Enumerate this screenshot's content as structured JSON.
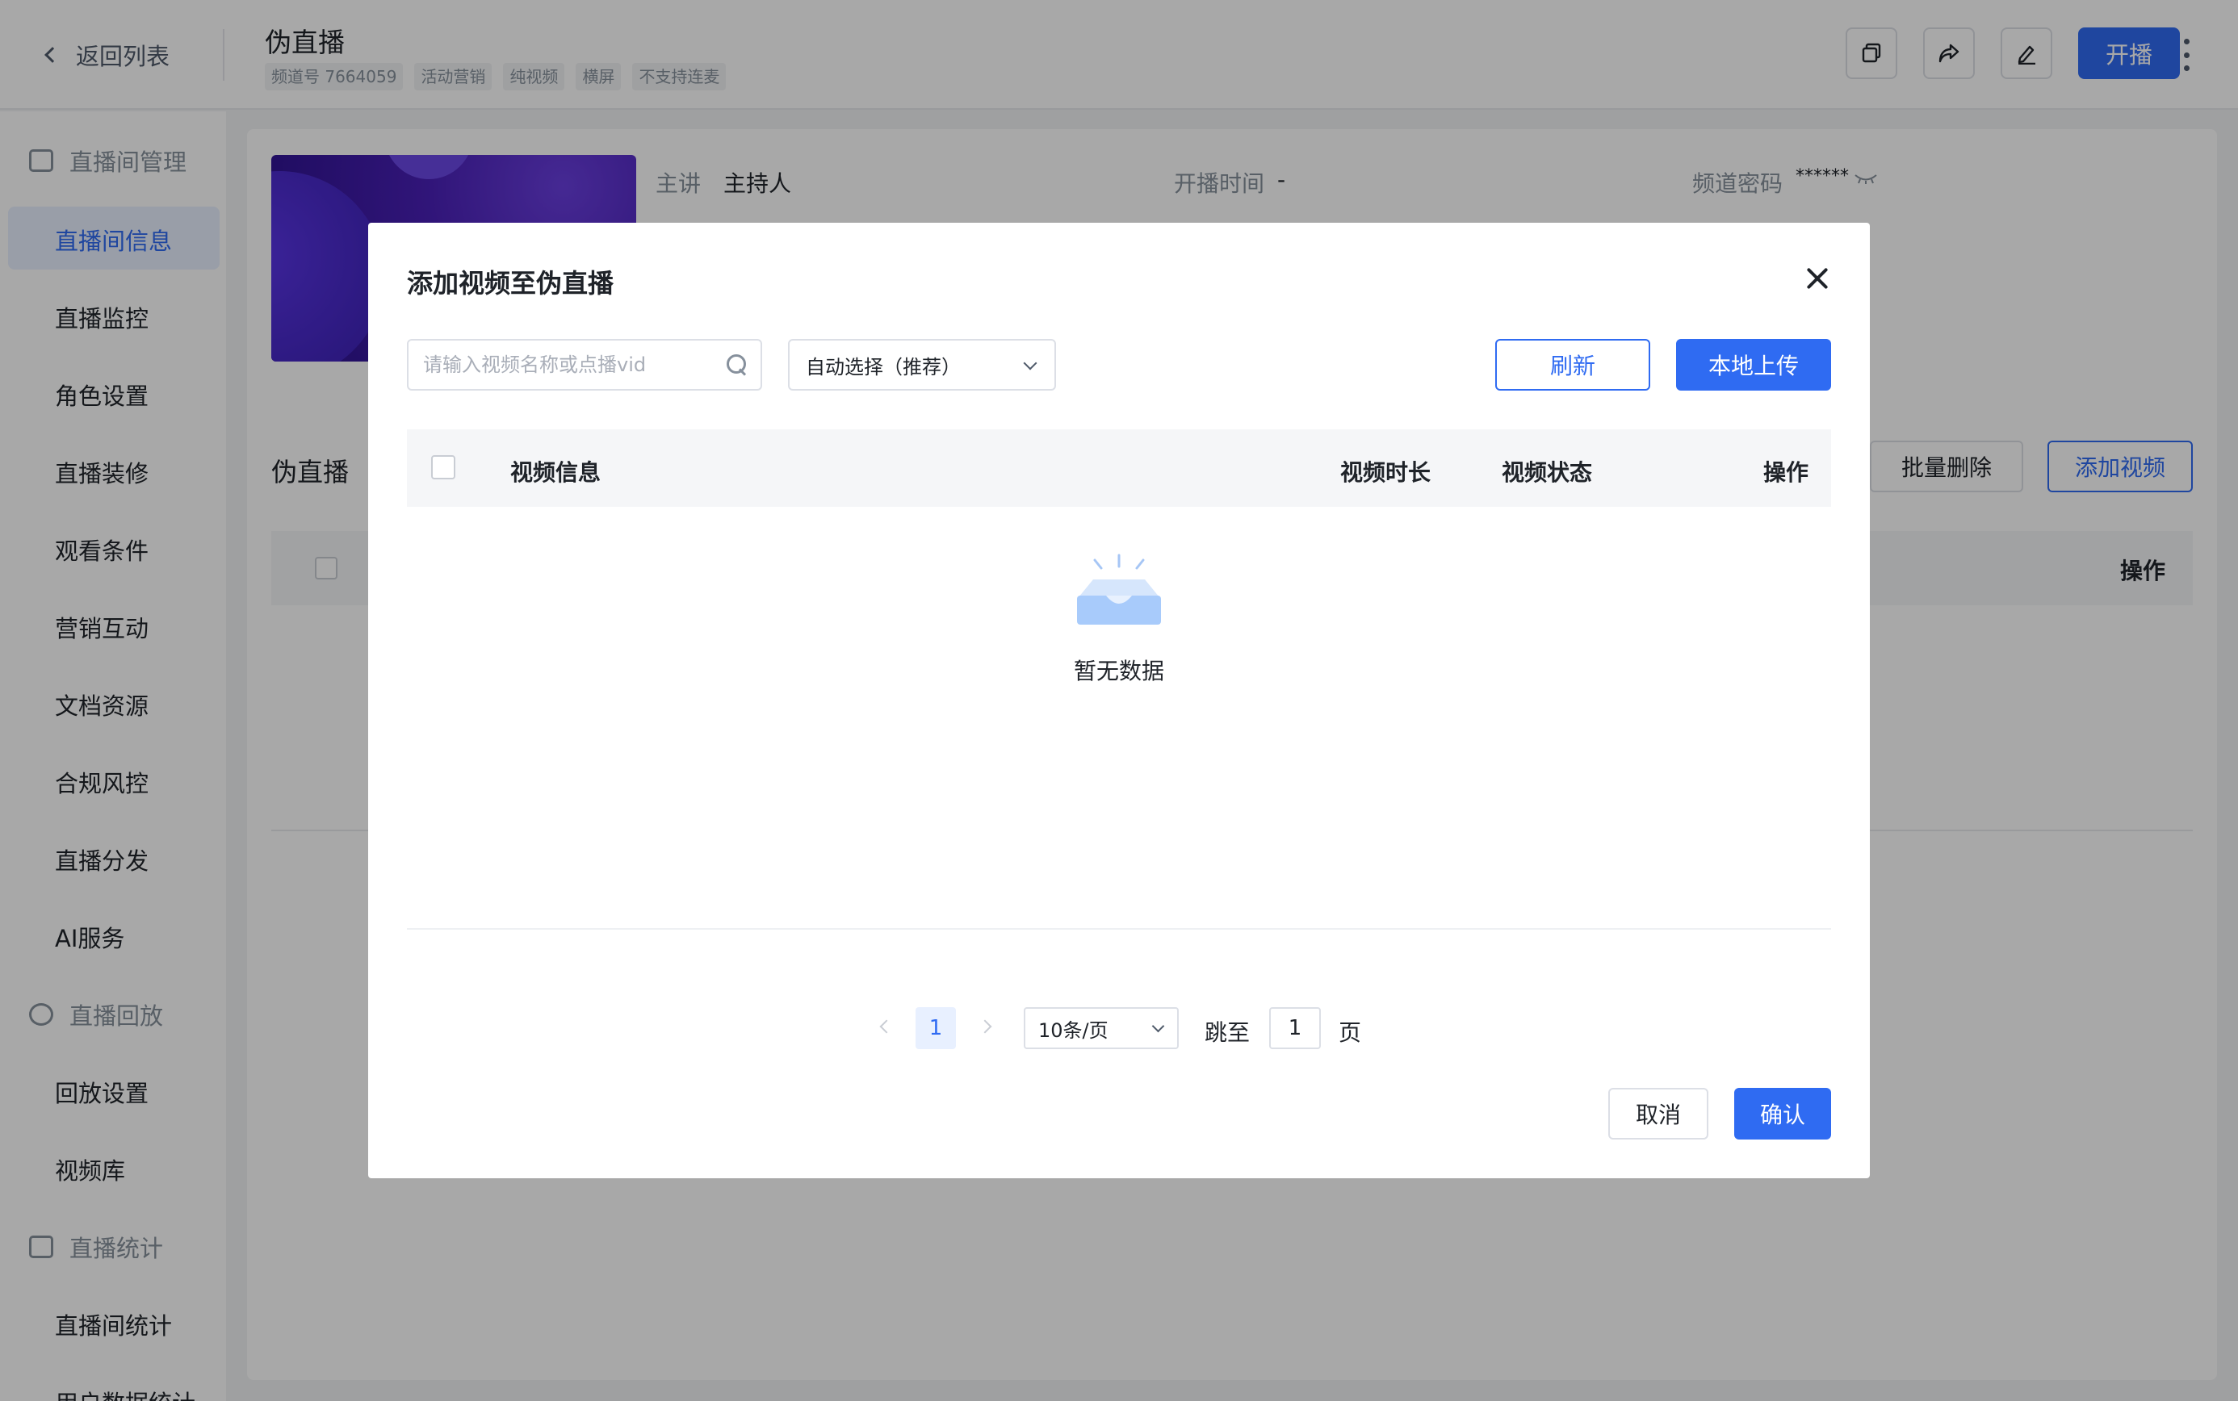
{
  "header": {
    "back_label": "返回列表",
    "channel_title": "伪直播",
    "tags": [
      "频道号 7664059",
      "活动营销",
      "纯视频",
      "横屏",
      "不支持连麦"
    ],
    "start_button": "开播",
    "icons": [
      "copy-icon",
      "share-icon",
      "edit-icon",
      "more-icon"
    ]
  },
  "sidebar": {
    "groups": [
      {
        "label": "直播间管理",
        "icon": "play-screen-icon",
        "items": [
          "直播间信息",
          "直播监控",
          "角色设置",
          "直播装修",
          "观看条件",
          "营销互动",
          "文档资源",
          "合规风控",
          "直播分发",
          "AI服务"
        ]
      },
      {
        "label": "直播回放",
        "icon": "replay-icon",
        "items": [
          "回放设置",
          "视频库"
        ]
      },
      {
        "label": "直播统计",
        "icon": "stats-icon",
        "items": [
          "直播间统计",
          "用户数据统计"
        ]
      }
    ],
    "active_item": "直播间信息"
  },
  "channel_info": {
    "presenter_label": "主讲",
    "presenter_value": "主持人",
    "start_time_label": "开播时间",
    "start_time_value": "-",
    "password_label": "频道密码",
    "password_value": "******"
  },
  "bg_section": {
    "title": "伪直播",
    "batch_delete": "批量删除",
    "add_video": "添加视频",
    "op_header": "操作"
  },
  "modal": {
    "title": "添加视频至伪直播",
    "search_placeholder": "请输入视频名称或点播vid",
    "select_value": "自动选择（推荐）",
    "refresh_button": "刷新",
    "upload_button": "本地上传",
    "columns": [
      "视频信息",
      "视频时长",
      "视频状态",
      "操作"
    ],
    "empty_text": "暂无数据",
    "pagination": {
      "current_page": "1",
      "page_size": "10条/页",
      "jump_label": "跳至",
      "jump_value": "1",
      "page_suffix": "页"
    },
    "cancel_button": "取消",
    "confirm_button": "确认"
  },
  "colors": {
    "primary": "#2f6bf2",
    "overlay": "rgba(0,0,0,0.34)"
  }
}
